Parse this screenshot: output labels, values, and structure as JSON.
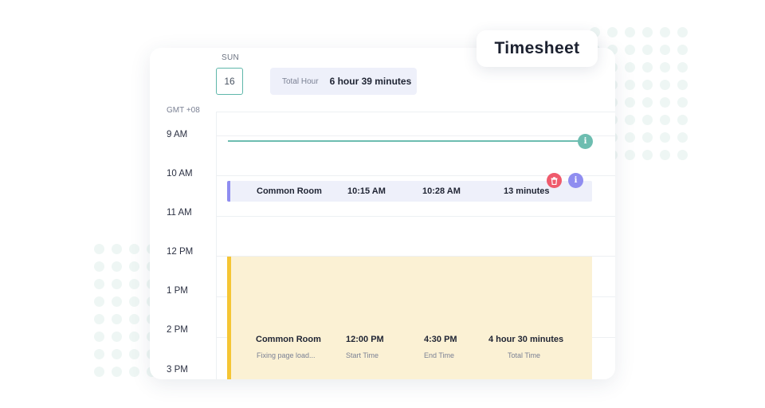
{
  "title": "Timesheet",
  "header": {
    "day_name": "SUN",
    "day_number": "16",
    "total_hour_label": "Total Hour",
    "total_hour_value": "6 hour 39 minutes"
  },
  "timezone": "GMT +08",
  "hours": [
    "9 AM",
    "10 AM",
    "11 AM",
    "12 PM",
    "1 PM",
    "2 PM",
    "3 PM"
  ],
  "entries": [
    {
      "location": "Common Room",
      "start": "10:15 AM",
      "end": "10:28 AM",
      "total": "13 minutes",
      "accent": "#8f8df0"
    },
    {
      "location": "Common Room",
      "description": "Fixing page load...",
      "start": "12:00 PM",
      "end": "4:30 PM",
      "total": "4 hour 30 minutes",
      "start_label": "Start Time",
      "end_label": "End Time",
      "total_label": "Total Time",
      "accent": "#f5c534"
    }
  ],
  "icons": {
    "info": "i",
    "delete": "trash-icon"
  },
  "colors": {
    "teal": "#6dbdb0",
    "purple": "#8f8df0",
    "red": "#ef5a6c",
    "yellow": "#f5c534"
  }
}
